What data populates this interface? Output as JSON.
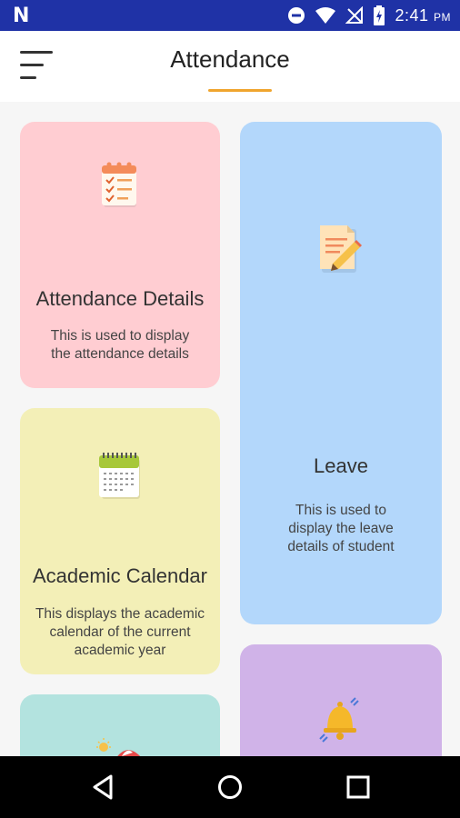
{
  "status_bar": {
    "time": "2:41",
    "ampm": "PM",
    "icons": [
      "notification-n-icon",
      "do-not-disturb-icon",
      "wifi-icon",
      "no-signal-icon",
      "battery-charging-icon"
    ]
  },
  "app_bar": {
    "title": "Attendance",
    "accent_color": "#f0a52e"
  },
  "cards": [
    {
      "key": "attendance_details",
      "title": "Attendance Details",
      "description": "This is used to display the attendance details",
      "color": "#ffcdd2",
      "icon": "checklist-icon"
    },
    {
      "key": "leave",
      "title": "Leave",
      "description": "This is used to display the leave details of student",
      "color": "#b3d7fb",
      "icon": "note-pencil-icon"
    },
    {
      "key": "academic_calendar",
      "title": "Academic Calendar",
      "description": "This displays the academic calendar of the current academic year",
      "color": "#f3efb7",
      "icon": "calendar-icon"
    },
    {
      "key": "holidays",
      "title": "",
      "description": "",
      "color": "#b3e3df",
      "icon": "beach-umbrella-icon"
    },
    {
      "key": "notifications",
      "title": "",
      "description": "",
      "color": "#d0b3e8",
      "icon": "bell-icon"
    }
  ],
  "nav_bar": {
    "buttons": [
      "back-icon",
      "home-icon",
      "recents-icon"
    ]
  }
}
